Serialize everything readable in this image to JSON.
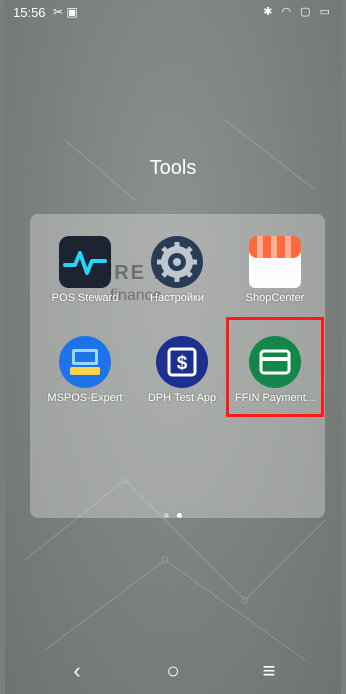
{
  "status": {
    "time": "15:56",
    "left_icons": "✂ ▣",
    "right_icons": "✱ ◠ ▢ ▭"
  },
  "folder": {
    "title": "Tools",
    "watermark": "FRE    M",
    "watermark2": "finance"
  },
  "apps": [
    {
      "label": "POS Steward"
    },
    {
      "label": "Настройки"
    },
    {
      "label": "ShopCenter"
    },
    {
      "label": "MSPOS-Expert"
    },
    {
      "label": "DPH Test App"
    },
    {
      "label": "FFIN Payment..."
    }
  ],
  "pager": {
    "active_index": 1
  },
  "navbar": {
    "back": "‹",
    "home": "○",
    "menu": "≡"
  },
  "colors": {
    "highlight": "#ff1a1a",
    "pos_bg": "#1b2430",
    "pos_wave": "#29d3f5",
    "shop_orange": "#ff6a3d",
    "mspos_blue": "#1e73e8",
    "dph_navy": "#1a2f8f",
    "ffin_green": "#14864a"
  }
}
